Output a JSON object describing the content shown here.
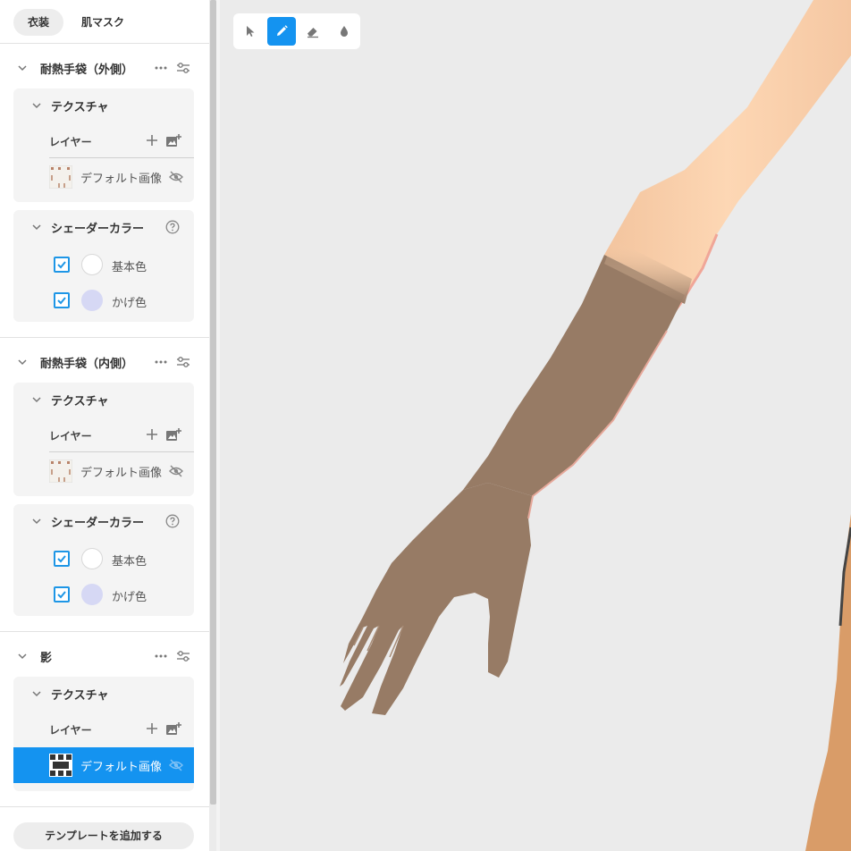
{
  "tabs": [
    "衣装",
    "肌マスク"
  ],
  "sections": [
    {
      "title": "耐熱手袋（外側）",
      "texture": {
        "title": "テクスチャ",
        "layer_label": "レイヤー",
        "item": "デフォルト画像"
      },
      "shader": {
        "title": "シェーダーカラー",
        "colors": [
          {
            "name": "基本色",
            "checked": true,
            "swatch": "#ffffff"
          },
          {
            "name": "かげ色",
            "checked": true,
            "swatch": "#d6d8f4"
          }
        ]
      }
    },
    {
      "title": "耐熱手袋（内側）",
      "texture": {
        "title": "テクスチャ",
        "layer_label": "レイヤー",
        "item": "デフォルト画像"
      },
      "shader": {
        "title": "シェーダーカラー",
        "colors": [
          {
            "name": "基本色",
            "checked": true,
            "swatch": "#ffffff"
          },
          {
            "name": "かげ色",
            "checked": true,
            "swatch": "#d6d8f4"
          }
        ]
      }
    },
    {
      "title": "影",
      "texture": {
        "title": "テクスチャ",
        "layer_label": "レイヤー",
        "item": "デフォルト画像"
      }
    }
  ],
  "add_template_label": "テンプレートを追加する",
  "toolbar": {
    "tools": [
      "select-tool",
      "pen-tool",
      "eraser-tool",
      "fill-tool"
    ],
    "active": "pen-tool"
  },
  "colors": {
    "accent": "#1493f0",
    "skin": "#fdd5b1",
    "glove": "#977b65"
  }
}
